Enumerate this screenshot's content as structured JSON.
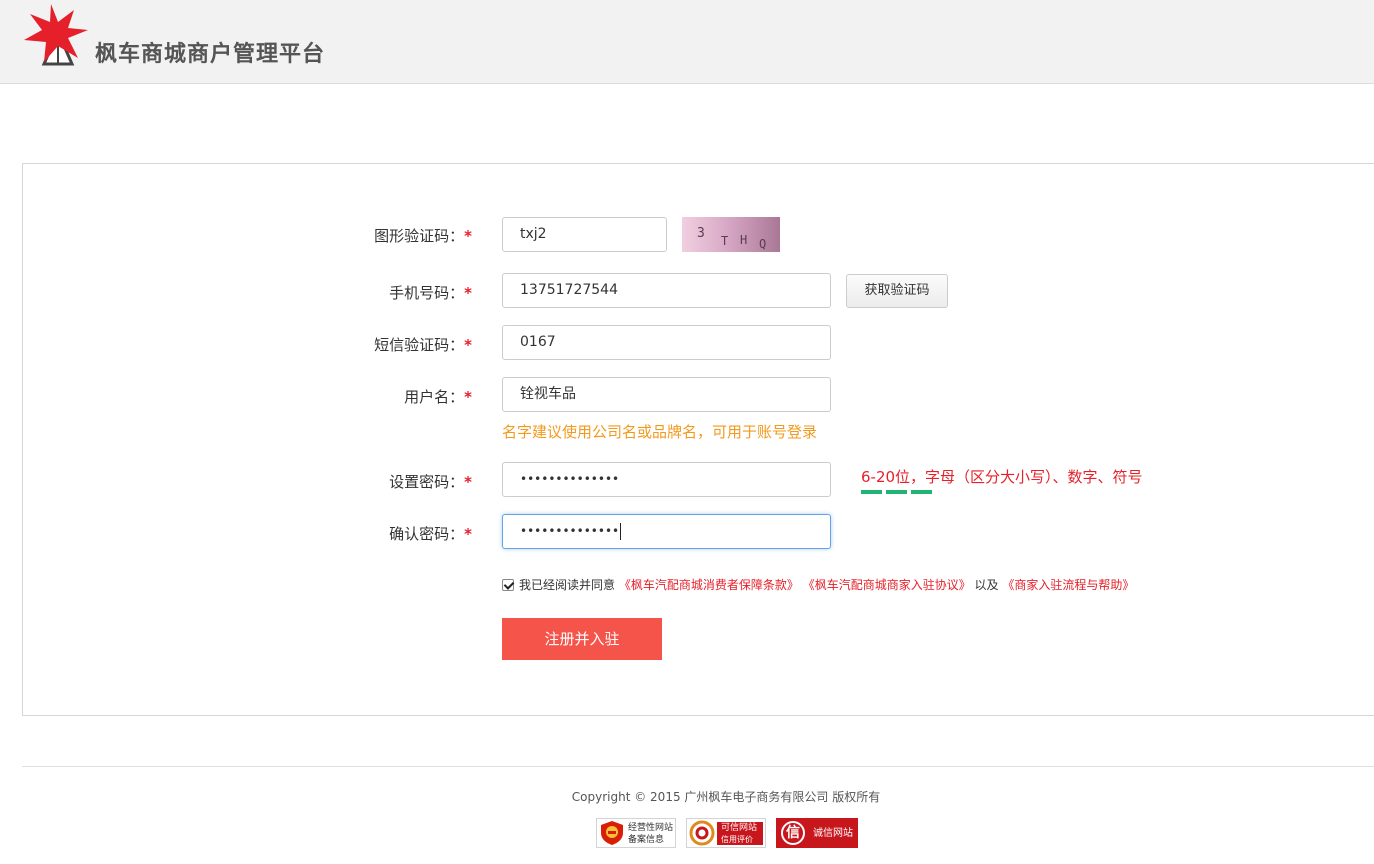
{
  "header": {
    "brand": "枫车商城商户管理平台"
  },
  "form": {
    "captcha": {
      "label": "图形验证码：",
      "required_mark": "*",
      "value": "txj2",
      "image_chars": [
        "3",
        "T",
        "H",
        "Q"
      ]
    },
    "phone": {
      "label": "手机号码：",
      "required_mark": "*",
      "value": "13751727544",
      "button": "获取验证码"
    },
    "sms_code": {
      "label": "短信验证码：",
      "required_mark": "*",
      "value": "0167"
    },
    "username": {
      "label": "用户名：",
      "required_mark": "*",
      "value": "铨视车品",
      "hint": "名字建议使用公司名或品牌名，可用于账号登录"
    },
    "password": {
      "label": "设置密码：",
      "required_mark": "*",
      "value": "••••••••••••••",
      "hint": "6-20位，字母（区分大小写）、数字、符号",
      "strength_level": 3,
      "strength_color": "#21b573"
    },
    "confirm_password": {
      "label": "确认密码：",
      "required_mark": "*",
      "value": "••••••••••••••"
    },
    "agreement": {
      "checked": true,
      "prefix": "我已经阅读并同意",
      "link1": "《枫车汽配商城消费者保障条款》",
      "link2": "《枫车汽配商城商家入驻协议》",
      "connector": "以及",
      "link3": "《商家入驻流程与帮助》"
    },
    "submit": "注册并入驻"
  },
  "footer": {
    "copyright": "Copyright © 2015 广州枫车电子商务有限公司 版权所有",
    "badges": [
      {
        "line1": "经营性网站",
        "line2": "备案信息"
      },
      {
        "line1": "可信网站",
        "line2": "信用评价"
      },
      {
        "line1": "诚信网站",
        "glyph": "信"
      }
    ]
  },
  "colors": {
    "accent": "#f5544a",
    "required": "#e5202a",
    "hint_orange": "#f39a1e"
  }
}
